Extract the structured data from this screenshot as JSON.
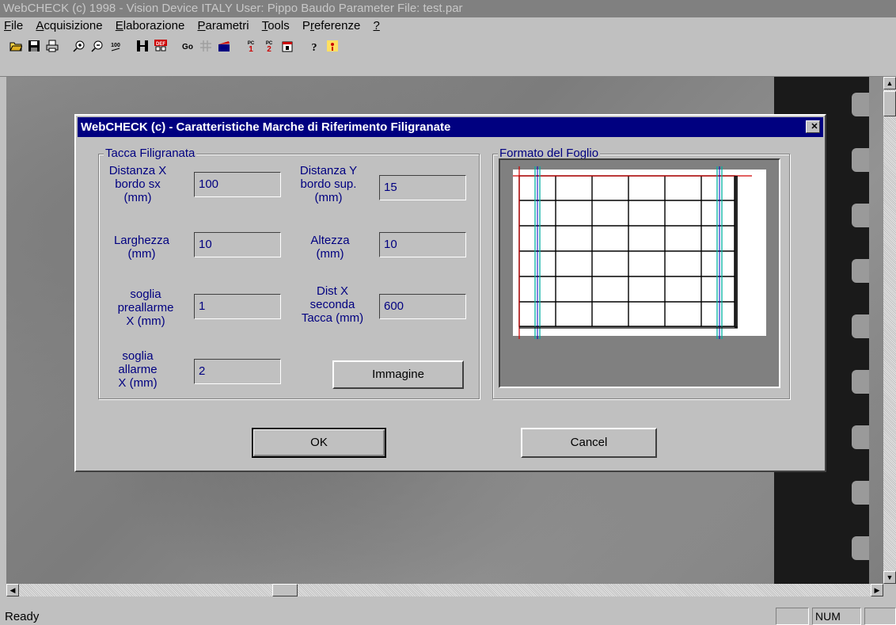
{
  "window": {
    "title": "WebCHECK (c) 1998 - Vision Device ITALY   User: Pippo Baudo   Parameter File: test.par"
  },
  "menu": [
    {
      "label": "File",
      "accel": "F",
      "rest": "ile"
    },
    {
      "label": "Acquisizione",
      "accel": "A",
      "rest": "cquisizione"
    },
    {
      "label": "Elaborazione",
      "accel": "E",
      "rest": "laborazione"
    },
    {
      "label": "Parametri",
      "accel": "P",
      "rest": "arametri"
    },
    {
      "label": "Tools",
      "accel": "T",
      "rest": "ools"
    },
    {
      "label": "Preferenze",
      "pre": "P",
      "accel": "r",
      "rest": "eferenze"
    },
    {
      "label": "?",
      "accel": "?",
      "rest": ""
    }
  ],
  "toolbar": {
    "icons": [
      "open-folder-icon",
      "save-disk-icon",
      "print-icon",
      "zoom-in-icon",
      "zoom-out-icon",
      "zoom-100-icon",
      "film-frame-icon",
      "def-icon",
      "go-icon",
      "grid-icon",
      "clapper-icon",
      "pc1-icon",
      "pc2-icon",
      "calendar-icon",
      "help-icon",
      "about-icon"
    ],
    "text": {
      "zoom100": "100",
      "def": "DEF",
      "go": "Go",
      "pc1": "PC",
      "pc1n": "1",
      "pc2": "PC",
      "pc2n": "2",
      "help": "?"
    }
  },
  "dialog": {
    "title": "WebCHECK (c) - Caratteristiche Marche di Riferimento Filigranate",
    "close": "✕",
    "group_left": "Tacca Filigranata",
    "group_right": "Formato del Foglio",
    "fields": {
      "distx_label": [
        "Distanza X",
        "bordo sx",
        "(mm)"
      ],
      "distx_value": "100",
      "disty_label": [
        "Distanza Y",
        "bordo sup.",
        "(mm)"
      ],
      "disty_value": "15",
      "larghezza_label": [
        "Larghezza",
        "(mm)"
      ],
      "larghezza_value": "10",
      "altezza_label": [
        "Altezza",
        "(mm)"
      ],
      "altezza_value": "10",
      "preallarme_label": [
        "soglia",
        "preallarme",
        "X (mm)"
      ],
      "preallarme_value": "1",
      "distx2_label": [
        "Dist X",
        "seconda",
        "Tacca (mm)"
      ],
      "distx2_value": "600",
      "allarme_label": [
        "soglia",
        "allarme",
        "X (mm)"
      ],
      "allarme_value": "2"
    },
    "buttons": {
      "immagine": "Immagine",
      "ok": "OK",
      "cancel": "Cancel"
    }
  },
  "status": {
    "text": "Ready",
    "num": "NUM"
  },
  "colors": {
    "title_bg": "#808080",
    "dialog_title_bg": "#000080",
    "label": "#000080",
    "face": "#c0c0c0"
  }
}
